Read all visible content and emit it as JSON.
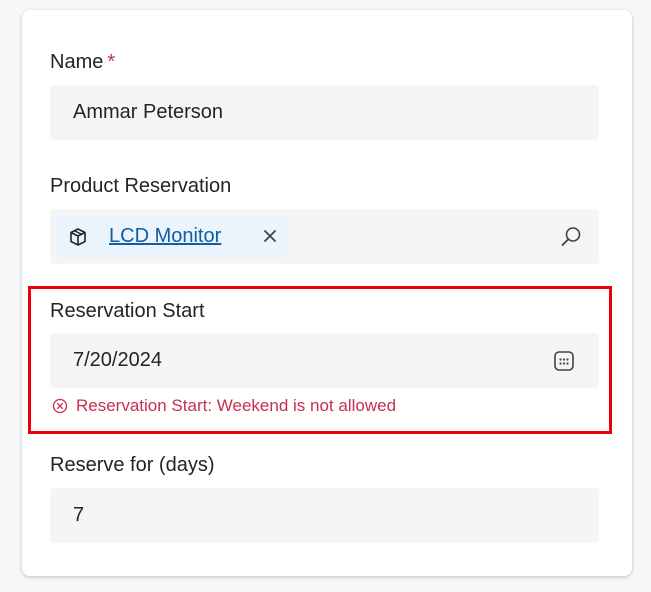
{
  "form": {
    "name": {
      "label": "Name",
      "required_marker": "*",
      "value": "Ammar Peterson"
    },
    "product_reservation": {
      "label": "Product Reservation",
      "tag_label": "LCD Monitor",
      "tag_icon": "box-icon",
      "remove_icon": "close-icon",
      "search_icon": "search-icon"
    },
    "reservation_start": {
      "label": "Reservation Start",
      "value": "7/20/2024",
      "calendar_icon": "calendar-icon",
      "error_icon": "error-circle-icon",
      "error_message": "Reservation Start: Weekend is not allowed"
    },
    "reserve_for": {
      "label": "Reserve for (days)",
      "value": "7"
    }
  },
  "colors": {
    "required": "#c4314b",
    "error_text": "#c4314b",
    "highlight_border": "#e8000b",
    "link": "#115ea3",
    "field_bg": "#f5f5f5",
    "tag_bg": "#ebf3fc"
  }
}
